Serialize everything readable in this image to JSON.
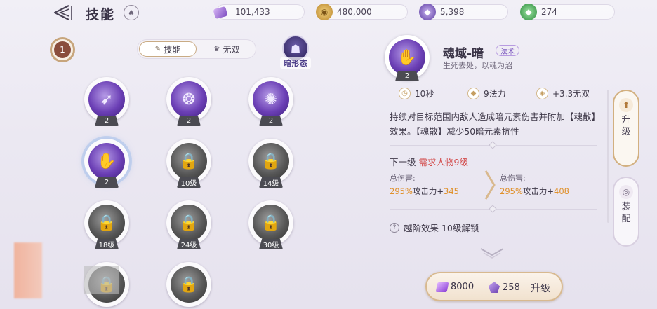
{
  "header": {
    "title": "技能",
    "currencies": [
      {
        "icon": "ticket-purple-icon",
        "value": "101,433"
      },
      {
        "icon": "coin-gold-icon",
        "value": "480,000"
      },
      {
        "icon": "gem-purple-icon",
        "value": "5,398"
      },
      {
        "icon": "gem-green-icon",
        "value": "274"
      }
    ]
  },
  "left": {
    "character_level": "1",
    "tabs": [
      {
        "label": "技能",
        "active": true
      },
      {
        "label": "无双",
        "active": false
      }
    ],
    "form_label": "暗形态",
    "skills": [
      {
        "tag": "2",
        "locked": false,
        "icon": "wing-slash-icon"
      },
      {
        "tag": "2",
        "locked": false,
        "icon": "orb-burst-icon"
      },
      {
        "tag": "2",
        "locked": false,
        "icon": "vortex-icon"
      },
      {
        "tag": "2",
        "locked": false,
        "icon": "dark-hands-icon",
        "selected": true
      },
      {
        "tag": "10级",
        "locked": true,
        "icon": "lock-icon"
      },
      {
        "tag": "14级",
        "locked": true,
        "icon": "lock-icon"
      },
      {
        "tag": "18级",
        "locked": true,
        "icon": "lock-icon"
      },
      {
        "tag": "24级",
        "locked": true,
        "icon": "lock-icon"
      },
      {
        "tag": "30级",
        "locked": true,
        "icon": "lock-icon"
      },
      {
        "tag": "",
        "locked": true,
        "icon": "lock-icon"
      },
      {
        "tag": "",
        "locked": true,
        "icon": "lock-icon"
      }
    ]
  },
  "detail": {
    "level": "2",
    "name": "魂域-暗",
    "type": "法术",
    "subtitle": "生死去处，以魂为沼",
    "stats": [
      {
        "icon": "clock-icon",
        "text": "10秒"
      },
      {
        "icon": "mana-icon",
        "text": "9法力"
      },
      {
        "icon": "musou-icon",
        "text": "+3.3无双"
      }
    ],
    "description": "持续对目标范围内敌人造成暗元素伤害并附加【魂散】效果。【魂散】减少50暗元素抗性",
    "next_level_label": "下一级",
    "next_level_requirement": "需求人物9级",
    "current_damage_label": "总伤害:",
    "current_damage_pct": "295%",
    "current_damage_mid": "攻击力+",
    "current_damage_flat": "345",
    "next_damage_label": "总伤害:",
    "next_damage_pct": "295%",
    "next_damage_mid": "攻击力+",
    "next_damage_flat": "408",
    "breakthrough": "越阶效果 10级解锁"
  },
  "upgrade": {
    "cost1": "8000",
    "cost2": "258",
    "button_label": "升级"
  },
  "side_tabs": [
    {
      "label": "升级",
      "active": true
    },
    {
      "label": "装配",
      "active": false
    }
  ]
}
